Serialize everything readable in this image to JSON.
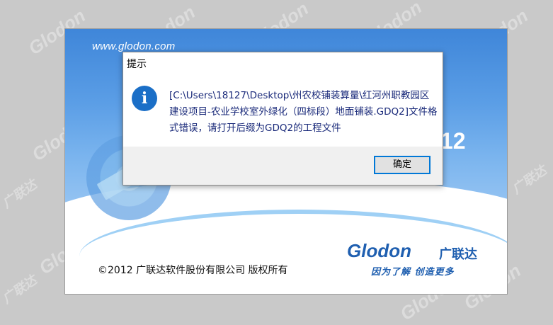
{
  "watermark": {
    "text": "Glodon",
    "text_cn": "广联达"
  },
  "splash": {
    "url": "www.glodon.com",
    "version": "12",
    "copyright": "©2012  广联达软件股份有限公司  版权所有",
    "brand": "Glodon",
    "brand_cn": "广联达",
    "slogan": "因为了解  创造更多",
    "colors": {
      "brand": "#1f5fb0",
      "top_gradient": "#3f86d9"
    }
  },
  "dialog": {
    "title": "提示",
    "icon": "info-icon",
    "icon_glyph": "i",
    "message": "[C:\\Users\\18127\\Desktop\\州农校铺装算量\\红河州职教园区建设项目-农业学校室外绿化（四标段）地面铺装.GDQ2]文件格式错误，请打开后缀为GDQ2的工程文件",
    "ok_label": "确定"
  }
}
